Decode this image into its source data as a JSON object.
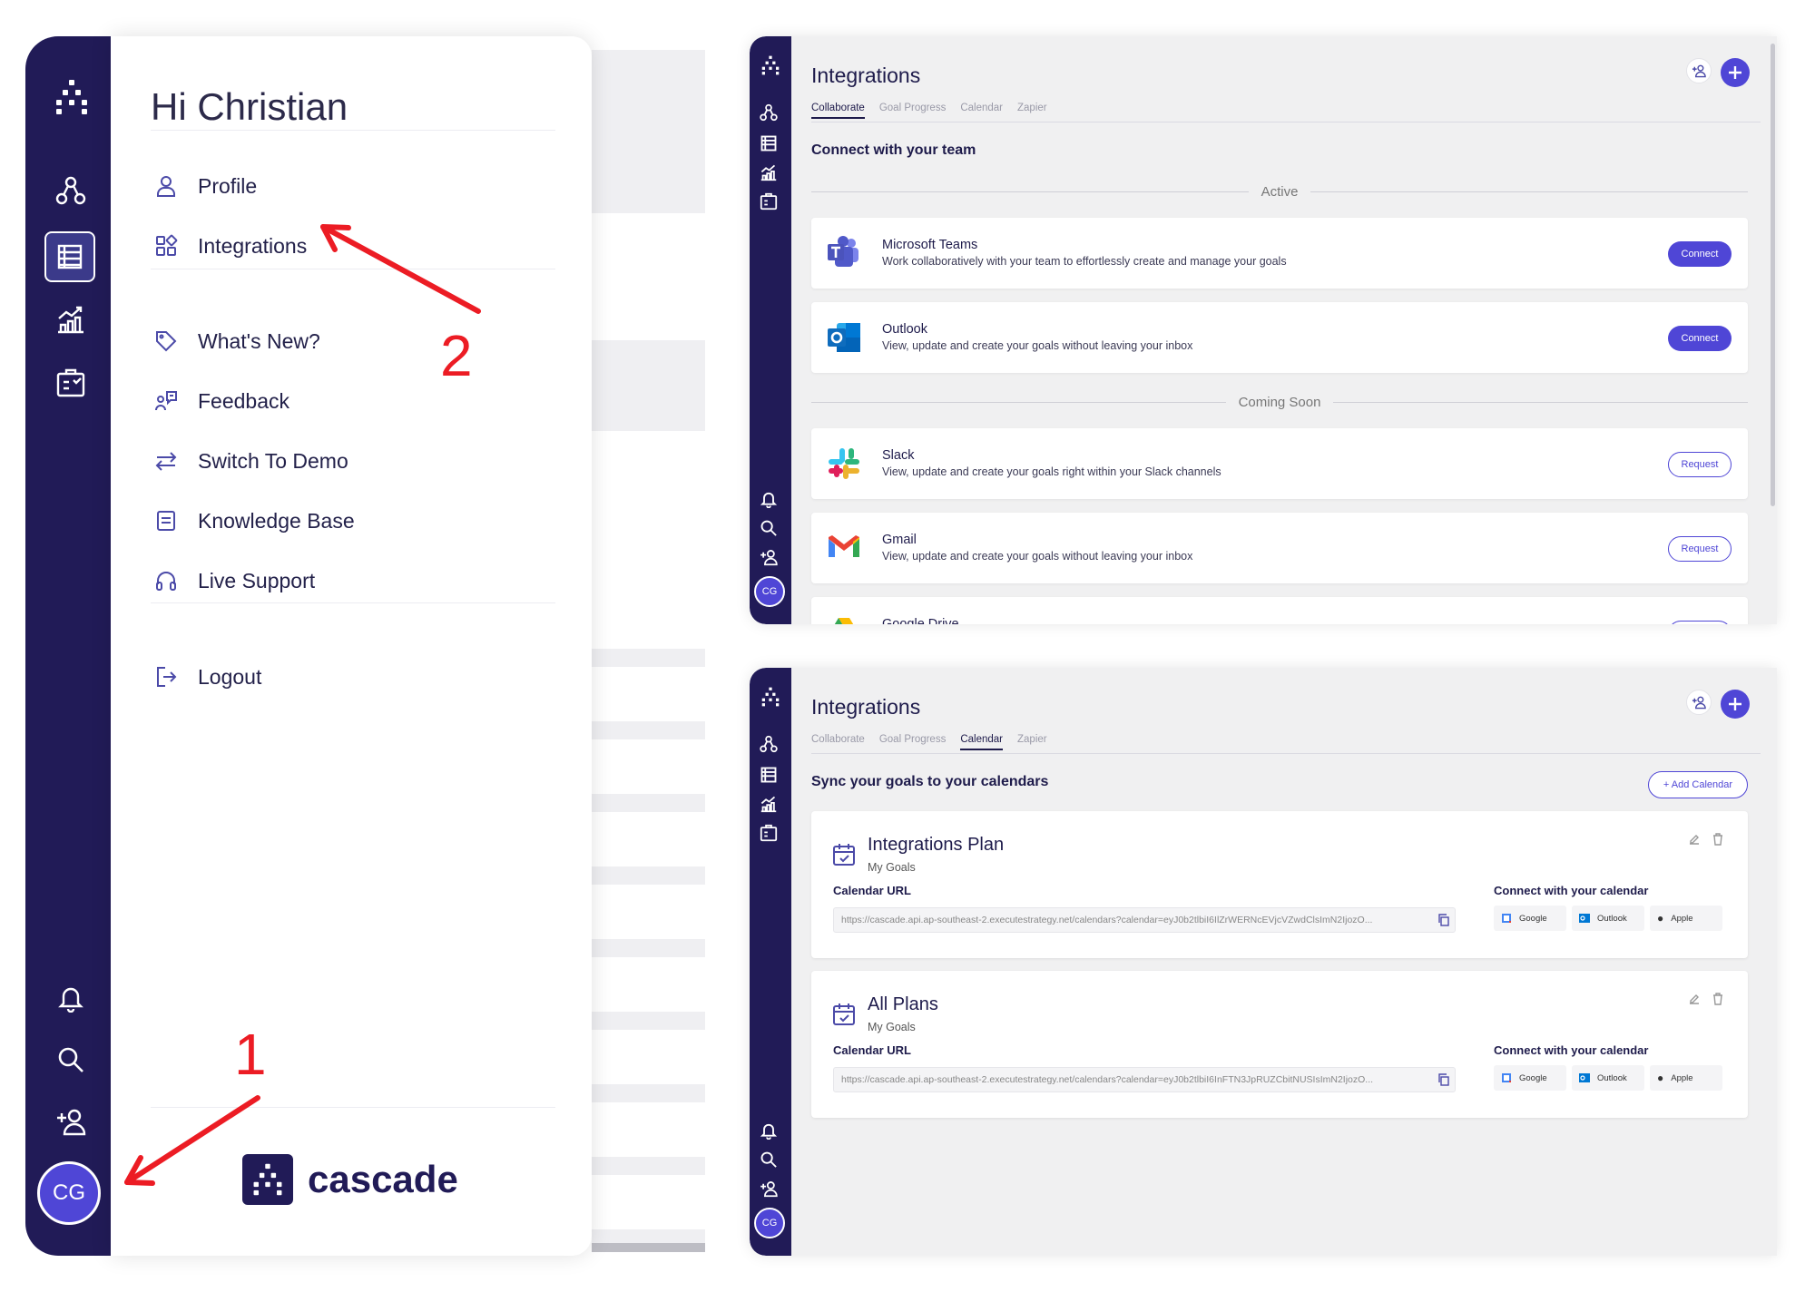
{
  "menu": {
    "greeting": "Hi Christian",
    "items": [
      {
        "label": "Profile",
        "icon": "user-icon"
      },
      {
        "label": "Integrations",
        "icon": "grid-icon"
      },
      {
        "label": "What's New?",
        "icon": "tag-icon"
      },
      {
        "label": "Feedback",
        "icon": "feedback-icon"
      },
      {
        "label": "Switch To Demo",
        "icon": "switch-arrows-icon"
      },
      {
        "label": "Knowledge Base",
        "icon": "document-icon"
      },
      {
        "label": "Live Support",
        "icon": "headphones-icon"
      },
      {
        "label": "Logout",
        "icon": "logout-icon"
      }
    ],
    "brand": "cascade",
    "avatar_initials": "CG"
  },
  "annotations": {
    "step1": "1",
    "step2": "2",
    "arrow_color": "#ec1c24"
  },
  "integrations_page": {
    "title": "Integrations",
    "tabs": [
      "Collaborate",
      "Goal Progress",
      "Calendar",
      "Zapier"
    ],
    "avatar_initials": "CG"
  },
  "collaborate": {
    "active_tab": "Collaborate",
    "heading": "Connect with your team",
    "active_label": "Active",
    "coming_soon_label": "Coming Soon",
    "active_integrations": [
      {
        "name": "Microsoft Teams",
        "desc": "Work collaboratively with your team to effortlessly create and manage your goals",
        "button": "Connect",
        "icon": "teams-icon"
      },
      {
        "name": "Outlook",
        "desc": "View, update and create your goals without leaving your inbox",
        "button": "Connect",
        "icon": "outlook-icon"
      }
    ],
    "coming_soon_integrations": [
      {
        "name": "Slack",
        "desc": "View, update and create your goals right within your Slack channels",
        "button": "Request",
        "icon": "slack-icon"
      },
      {
        "name": "Gmail",
        "desc": "View, update and create your goals without leaving your inbox",
        "button": "Request",
        "icon": "gmail-icon"
      },
      {
        "name": "Google Drive",
        "icon": "google-drive-icon"
      }
    ]
  },
  "calendar": {
    "active_tab": "Calendar",
    "heading": "Sync your goals to your calendars",
    "add_button": "+ Add Calendar",
    "url_label": "Calendar URL",
    "connect_label": "Connect with your calendar",
    "providers": [
      "Google",
      "Outlook",
      "Apple"
    ],
    "calendars": [
      {
        "name": "Integrations Plan",
        "sub": "My Goals",
        "url": "https://cascade.api.ap-southeast-2.executestrategy.net/calendars?calendar=eyJ0b2tlbiI6IlZrWERNcEVjcVZwdClsImN2IjozO..."
      },
      {
        "name": "All Plans",
        "sub": "My Goals",
        "url": "https://cascade.api.ap-southeast-2.executestrategy.net/calendars?calendar=eyJ0b2tlbiI6InFTN3JpRUZCbitNUSIsImN2IjozO..."
      }
    ]
  },
  "colors": {
    "rail": "#211b57",
    "accent": "#4f46d6",
    "text": "#1e1b4b"
  }
}
